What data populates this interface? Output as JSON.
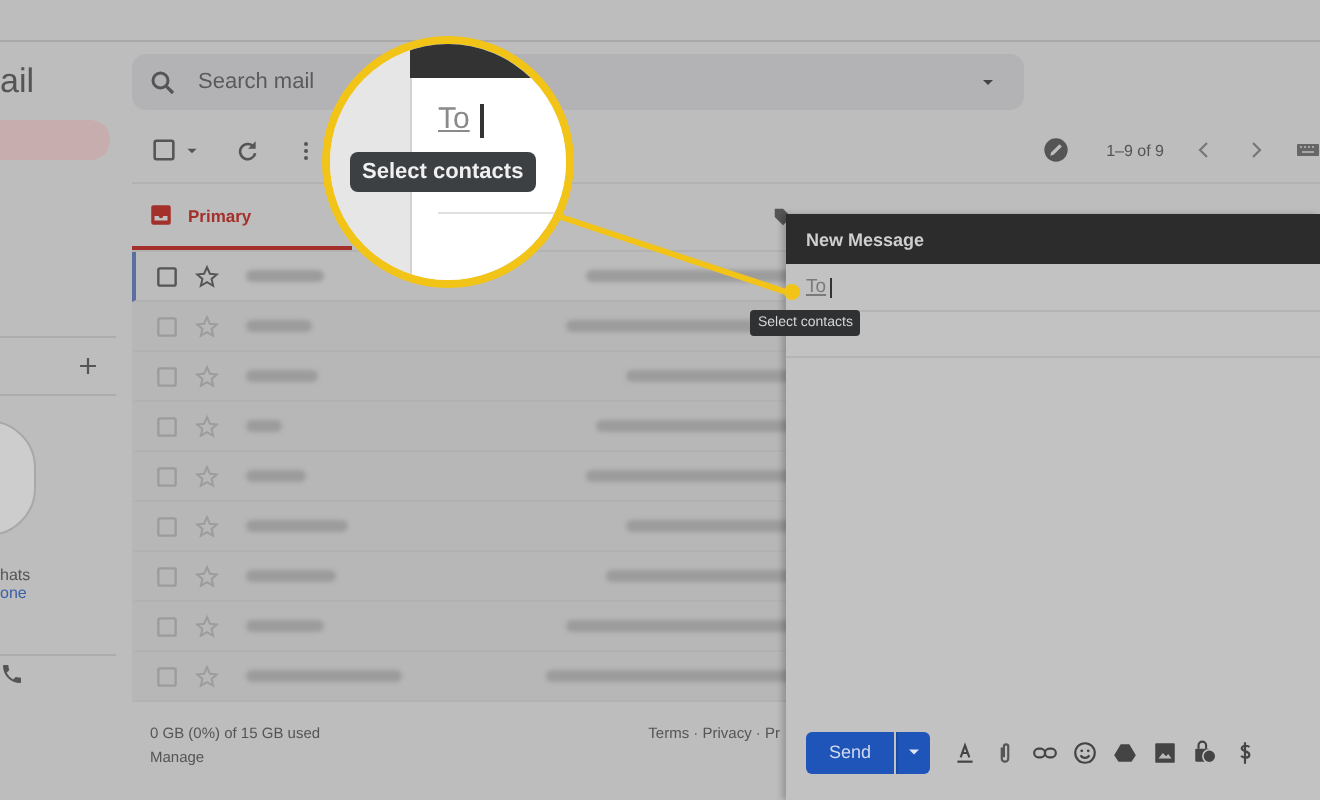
{
  "app": {
    "logo_fragment": "ail"
  },
  "search": {
    "placeholder": "Search mail"
  },
  "toolbar": {
    "select_all_checked": false,
    "pagination": "1–9 of 9"
  },
  "tabs": [
    {
      "label": "Primary",
      "selected": true
    }
  ],
  "sidebar": {
    "chat_text": "hats",
    "chat_link": "one"
  },
  "messages": [
    {
      "selected": true
    },
    {
      "selected": false
    },
    {
      "selected": false
    },
    {
      "selected": false
    },
    {
      "selected": false
    },
    {
      "selected": false
    },
    {
      "selected": false
    },
    {
      "selected": false
    },
    {
      "selected": false
    }
  ],
  "footer": {
    "storage": "0 GB (0%) of 15 GB used",
    "manage": "Manage",
    "links": "Terms · Privacy · Pr"
  },
  "compose": {
    "title": "New Message",
    "to_label": "To",
    "tooltip": "Select contacts",
    "send": "Send"
  },
  "magnifier": {
    "to_label": "To",
    "tooltip": "Select contacts"
  }
}
